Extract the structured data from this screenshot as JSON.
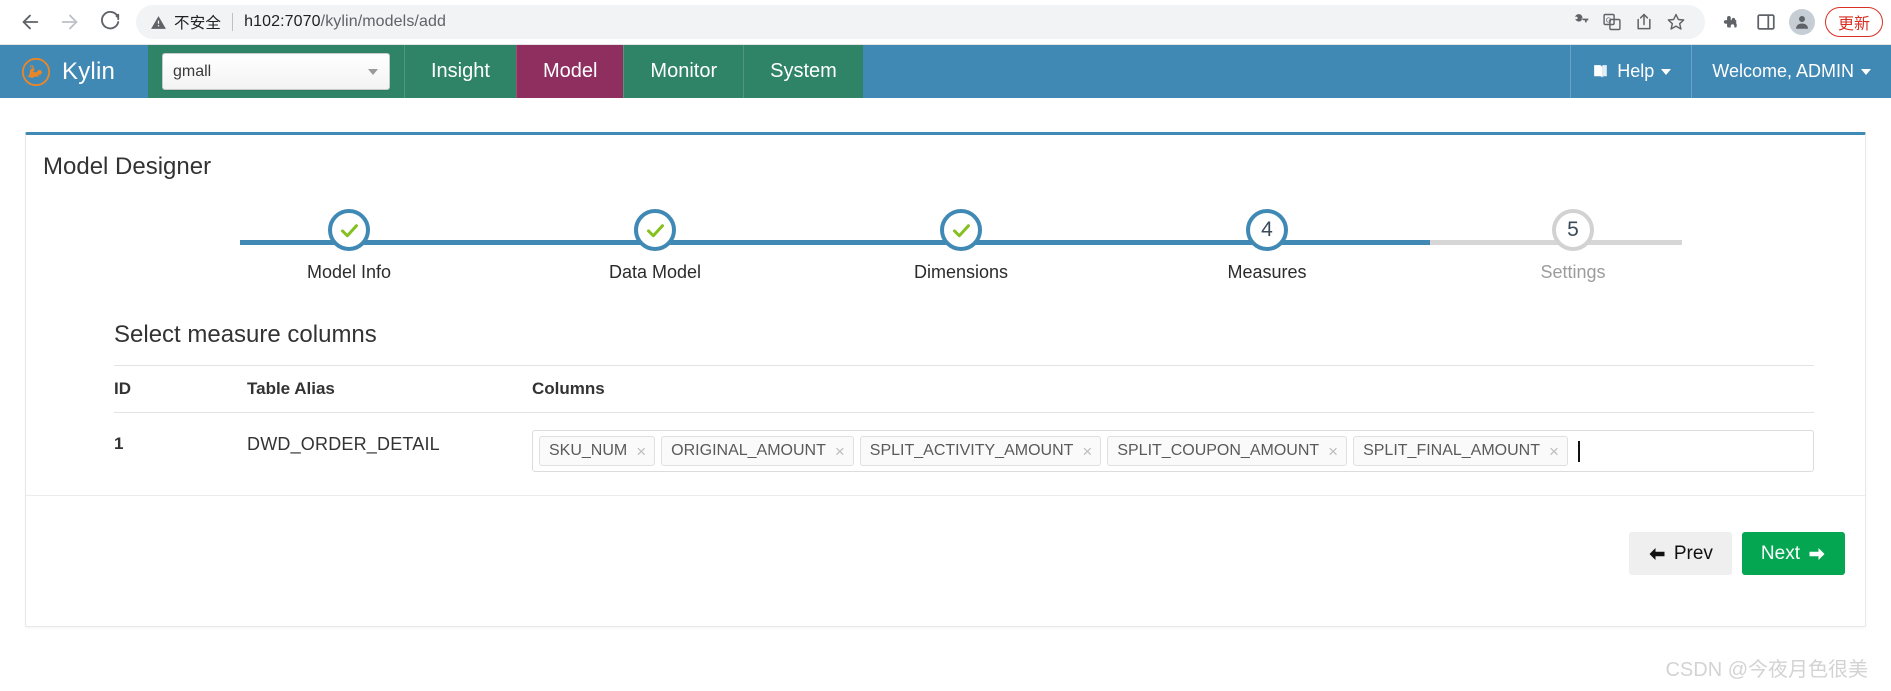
{
  "browser": {
    "back_icon": "arrow-left-icon",
    "forward_icon": "arrow-right-icon",
    "reload_icon": "reload-icon",
    "security_label": "不安全",
    "url_host": "h102:7070",
    "url_path": "/kylin/models/add",
    "icons": [
      "key-icon",
      "translate-icon",
      "share-icon",
      "bookmark-star-icon",
      "extensions-puzzle-icon",
      "sidepanel-icon",
      "profile-avatar-icon"
    ],
    "update_label": "更新",
    "update_color": "#d93025"
  },
  "topnav": {
    "brand": "Kylin",
    "project_value": "gmall",
    "items": [
      {
        "label": "Insight",
        "active": false
      },
      {
        "label": "Model",
        "active": true
      },
      {
        "label": "Monitor",
        "active": false
      },
      {
        "label": "System",
        "active": false
      }
    ],
    "help_label": "Help",
    "user_label": "Welcome, ADMIN",
    "nav_bg": "#4189b5",
    "nav_green": "#2f8468",
    "active_bg": "#8e2f5f"
  },
  "panel": {
    "title": "Model Designer",
    "accent": "#4189b5"
  },
  "wizard": {
    "steps": [
      {
        "num": "1",
        "label": "Model Info",
        "state": "done"
      },
      {
        "num": "2",
        "label": "Data Model",
        "state": "done"
      },
      {
        "num": "3",
        "label": "Dimensions",
        "state": "done"
      },
      {
        "num": "4",
        "label": "Measures",
        "state": "current"
      },
      {
        "num": "5",
        "label": "Settings",
        "state": "todo"
      }
    ],
    "progress_percent": 78
  },
  "measures": {
    "section_title": "Select measure columns",
    "headers": {
      "id": "ID",
      "alias": "Table Alias",
      "columns": "Columns"
    },
    "rows": [
      {
        "id": "1",
        "alias": "DWD_ORDER_DETAIL",
        "columns": [
          "SKU_NUM",
          "ORIGINAL_AMOUNT",
          "SPLIT_ACTIVITY_AMOUNT",
          "SPLIT_COUPON_AMOUNT",
          "SPLIT_FINAL_AMOUNT"
        ]
      }
    ],
    "remove_glyph": "×"
  },
  "footer": {
    "prev_label": "Prev",
    "next_label": "Next",
    "prev_arrow": "←",
    "next_arrow": "→",
    "next_color": "#05a651"
  },
  "watermark": "CSDN @今夜月色很美"
}
